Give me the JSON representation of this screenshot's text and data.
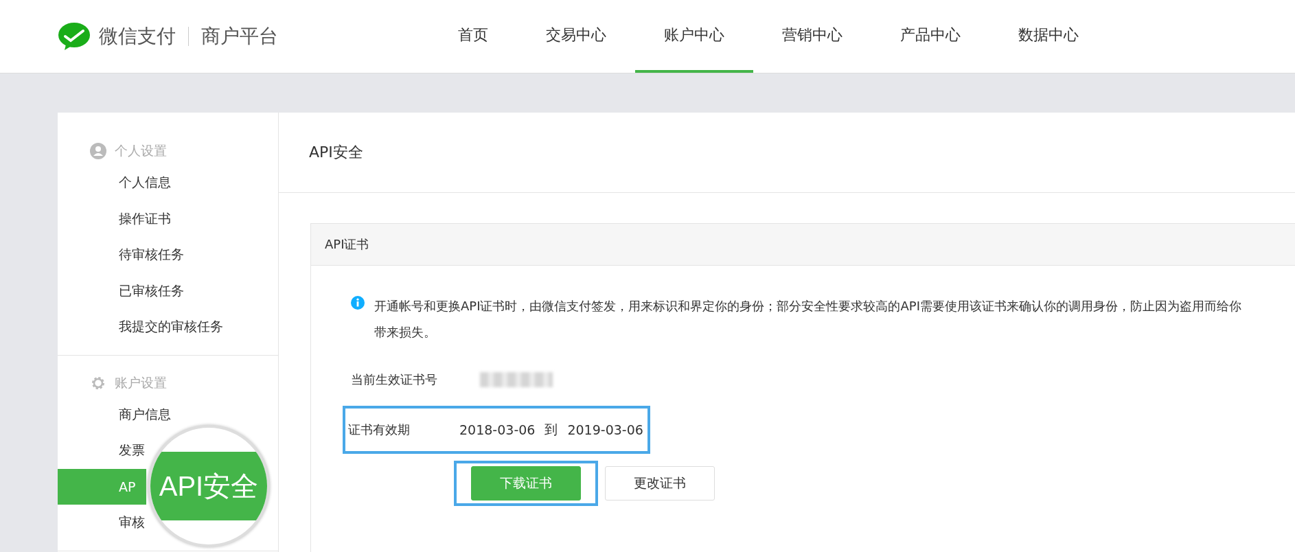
{
  "header": {
    "brand": "微信支付",
    "platform": "商户平台",
    "nav": [
      {
        "label": "首页",
        "selected": false
      },
      {
        "label": "交易中心",
        "selected": false
      },
      {
        "label": "账户中心",
        "selected": true
      },
      {
        "label": "营销中心",
        "selected": false
      },
      {
        "label": "产品中心",
        "selected": false
      },
      {
        "label": "数据中心",
        "selected": false
      }
    ]
  },
  "sidebar": {
    "groups": [
      {
        "title": "个人设置",
        "kind": "person",
        "items": [
          {
            "label": "个人信息",
            "selected": false
          },
          {
            "label": "操作证书",
            "selected": false
          },
          {
            "label": "待审核任务",
            "selected": false
          },
          {
            "label": "已审核任务",
            "selected": false
          },
          {
            "label": "我提交的审核任务",
            "selected": false
          }
        ]
      },
      {
        "title": "账户设置",
        "kind": "gear",
        "items": [
          {
            "label": "商户信息",
            "selected": false
          },
          {
            "label": "发票",
            "selected": false
          },
          {
            "label": "AP",
            "selected": true
          },
          {
            "label": "审核",
            "selected": false
          }
        ]
      }
    ]
  },
  "magnifier": {
    "label": "API安全"
  },
  "page_title": "API安全",
  "panel": {
    "title": "API证书",
    "notice": "开通帐号和更换API证书时，由微信支付签发，用来标识和界定你的身份；部分安全性要求较高的API需要使用该证书来确认你的调用身份，防止因为盗用而给你带来损失。",
    "current_label": "当前生效证书号",
    "validity_label": "证书有效期",
    "valid_from": "2018-03-06",
    "to": "到",
    "valid_until": "2019-03-06",
    "buttons": [
      {
        "label": "下载证书",
        "kind": "primary"
      },
      {
        "label": "更改证书",
        "kind": "default"
      }
    ]
  }
}
